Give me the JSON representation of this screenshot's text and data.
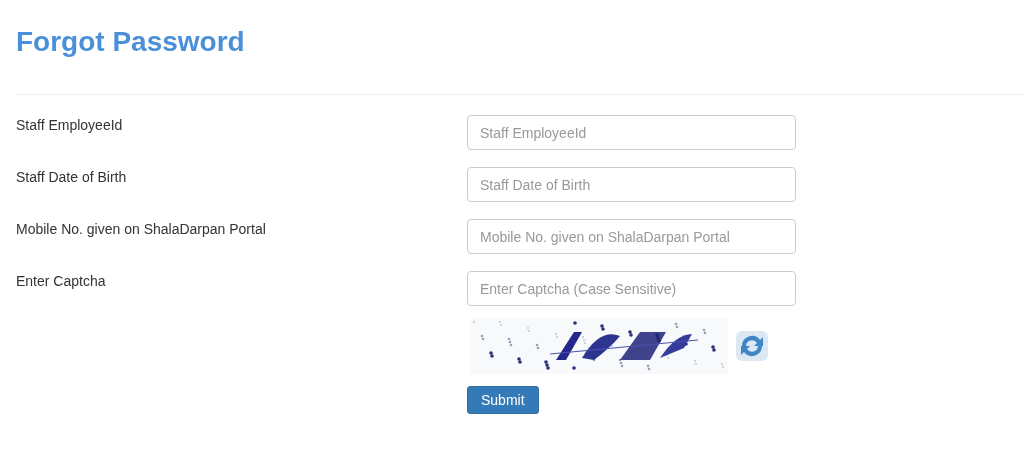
{
  "title": "Forgot Password",
  "fields": [
    {
      "label": "Staff EmployeeId",
      "placeholder": "Staff EmployeeId"
    },
    {
      "label": "Staff Date of Birth",
      "placeholder": "Staff Date of Birth"
    },
    {
      "label": "Mobile No. given on ShalaDarpan Portal",
      "placeholder": "Mobile No. given on ShalaDarpan Portal"
    },
    {
      "label": "Enter Captcha",
      "placeholder": "Enter Captcha (Case Sensitive)"
    }
  ],
  "submit_button": "Submit"
}
